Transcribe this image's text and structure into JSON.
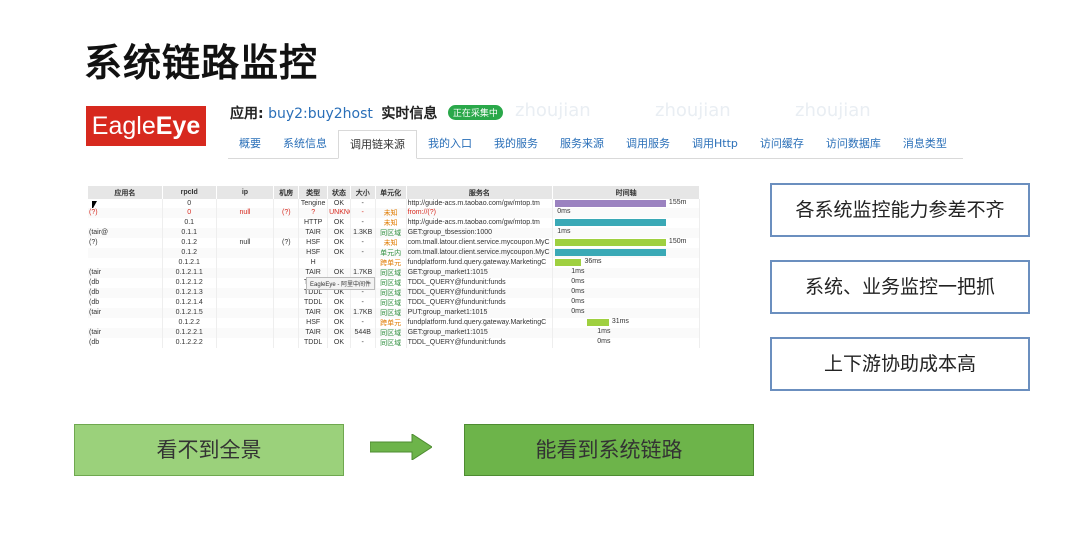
{
  "slide": {
    "title": "系统链路监控"
  },
  "eagleeye": {
    "logo_prefix": "Eagle",
    "logo_bold": "Eye",
    "app_label": "应用:",
    "app_name": "buy2:buy2host",
    "realtime_label": "实时信息",
    "status_badge": "正在采集中",
    "watermark": "zhoujian",
    "tabs": [
      "概要",
      "系统信息",
      "调用链来源",
      "我的入口",
      "我的服务",
      "服务来源",
      "调用服务",
      "调用Http",
      "访问缓存",
      "访问数据库",
      "消息类型"
    ],
    "active_tab": 2
  },
  "trace_table": {
    "headers": [
      "应用名",
      "rpcId",
      "ip",
      "机房",
      "类型",
      "状态",
      "大小",
      "单元化",
      "服务名",
      "时间轴"
    ],
    "tooltip": "EagleEye - 阿里中间件",
    "rows": [
      {
        "app": "",
        "rpc": "0",
        "ip": "",
        "room": "",
        "type": "Tengine",
        "status": "OK",
        "size": "-",
        "unit": "",
        "svc": "http://guide-acs.m.taobao.com/gw/mtop.tm",
        "bar": {
          "start": 0,
          "len": 0.93,
          "color": "#9b82c0"
        },
        "time": "155m",
        "cls": ""
      },
      {
        "app": "(?)",
        "rpc": "0",
        "ip": "null",
        "room": "(?)",
        "type": "?",
        "status": "UNKNOW",
        "size": "-",
        "unit": "未知",
        "svc": "from://(?)",
        "bar": null,
        "time": "0ms",
        "cls": "red"
      },
      {
        "app": "",
        "rpc": "0.1",
        "ip": "",
        "room": "",
        "type": "HTTP",
        "status": "OK",
        "size": "-",
        "unit": "未知",
        "svc": "http://guide-acs.m.taobao.com/gw/mtop.tm",
        "bar": {
          "start": 0,
          "len": 0.93,
          "color": "#3aa9b6"
        },
        "time": "",
        "cls": ""
      },
      {
        "app": "(tair@",
        "rpc": "0.1.1",
        "ip": "",
        "room": "",
        "type": "TAIR",
        "status": "OK",
        "size": "1.3KB",
        "unit": "同区域",
        "svc": "GET:group_tbsession:1000",
        "bar": null,
        "time": "1ms",
        "cls": ""
      },
      {
        "app": "(?)",
        "rpc": "0.1.2",
        "ip": "null",
        "room": "(?)",
        "type": "HSF",
        "status": "OK",
        "size": "-",
        "unit": "未知",
        "svc": "com.tmall.latour.client.service.mycoupon.MyC",
        "bar": {
          "start": 0,
          "len": 0.93,
          "color": "#9fd040"
        },
        "time": "150m",
        "cls": ""
      },
      {
        "app": "",
        "rpc": "0.1.2",
        "ip": "",
        "room": "",
        "type": "HSF",
        "status": "OK",
        "size": "-",
        "unit": "单元内",
        "svc": "com.tmall.latour.client.service.mycoupon.MyC",
        "bar": {
          "start": 0,
          "len": 0.93,
          "color": "#3aa9b6"
        },
        "time": "",
        "cls": ""
      },
      {
        "app": "",
        "rpc": "0.1.2.1",
        "ip": "",
        "room": "",
        "type": "H",
        "status": "",
        "size": "",
        "unit": "跨单元",
        "svc": "fundplatform.fund.query.gateway.MarketingC",
        "bar": {
          "start": 0,
          "len": 0.22,
          "color": "#9fd040"
        },
        "time": "36ms",
        "cls": ""
      },
      {
        "app": "(tair",
        "rpc": "0.1.2.1.1",
        "ip": "",
        "room": "",
        "type": "TAIR",
        "status": "OK",
        "size": "1.7KB",
        "unit": "同区域",
        "svc": "GET:group_market1:1015",
        "bar": null,
        "time": "1ms",
        "cls": ""
      },
      {
        "app": "(db",
        "rpc": "0.1.2.1.2",
        "ip": "",
        "room": "",
        "type": "TDDL",
        "status": "OK",
        "size": "-",
        "unit": "同区域",
        "svc": "TDDL_QUERY@fundunit:funds",
        "bar": null,
        "time": "0ms",
        "cls": ""
      },
      {
        "app": "(db",
        "rpc": "0.1.2.1.3",
        "ip": "",
        "room": "",
        "type": "TDDL",
        "status": "OK",
        "size": "-",
        "unit": "同区域",
        "svc": "TDDL_QUERY@fundunit:funds",
        "bar": null,
        "time": "0ms",
        "cls": ""
      },
      {
        "app": "(db",
        "rpc": "0.1.2.1.4",
        "ip": "",
        "room": "",
        "type": "TDDL",
        "status": "OK",
        "size": "-",
        "unit": "同区域",
        "svc": "TDDL_QUERY@fundunit:funds",
        "bar": null,
        "time": "0ms",
        "cls": ""
      },
      {
        "app": "(tair",
        "rpc": "0.1.2.1.5",
        "ip": "",
        "room": "",
        "type": "TAIR",
        "status": "OK",
        "size": "1.7KB",
        "unit": "同区域",
        "svc": "PUT:group_market1:1015",
        "bar": null,
        "time": "0ms",
        "cls": ""
      },
      {
        "app": "",
        "rpc": "0.1.2.2",
        "ip": "",
        "room": "",
        "type": "HSF",
        "status": "OK",
        "size": "-",
        "unit": "跨单元",
        "svc": "fundplatform.fund.query.gateway.MarketingC",
        "bar": {
          "start": 0.27,
          "len": 0.18,
          "color": "#9fd040"
        },
        "time": "31ms",
        "cls": ""
      },
      {
        "app": "(tair",
        "rpc": "0.1.2.2.1",
        "ip": "",
        "room": "",
        "type": "TAIR",
        "status": "OK",
        "size": "544B",
        "unit": "同区域",
        "svc": "GET:group_market1:1015",
        "bar": null,
        "time": "1ms",
        "cls": ""
      },
      {
        "app": "(db",
        "rpc": "0.1.2.2.2",
        "ip": "",
        "room": "",
        "type": "TDDL",
        "status": "OK",
        "size": "-",
        "unit": "同区域",
        "svc": "TDDL_QUERY@fundunit:funds",
        "bar": null,
        "time": "0ms",
        "cls": ""
      }
    ]
  },
  "points": [
    "各系统监控能力参差不齐",
    "系统、业务监控一把抓",
    "上下游协助成本高"
  ],
  "flow": {
    "from": "看不到全景",
    "to": "能看到系统链路",
    "arrow_color": "#6db44a"
  }
}
